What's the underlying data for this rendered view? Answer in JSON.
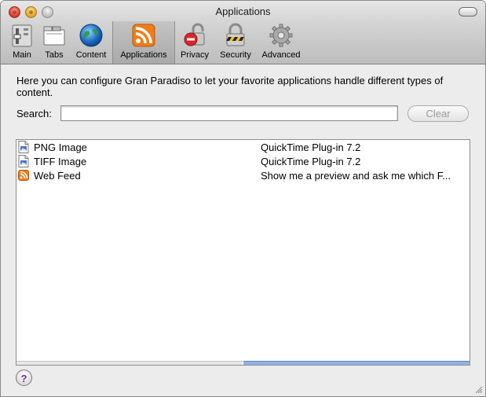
{
  "window": {
    "title": "Applications"
  },
  "toolbar": {
    "items": [
      {
        "label": "Main",
        "icon": "main-switch-icon"
      },
      {
        "label": "Tabs",
        "icon": "tabs-icon"
      },
      {
        "label": "Content",
        "icon": "globe-icon"
      },
      {
        "label": "Applications",
        "icon": "rss-feed-icon",
        "selected": true
      },
      {
        "label": "Privacy",
        "icon": "privacy-icon"
      },
      {
        "label": "Security",
        "icon": "padlock-icon"
      },
      {
        "label": "Advanced",
        "icon": "gear-icon"
      }
    ]
  },
  "description": "Here you can configure Gran Paradiso to let your favorite applications handle different types of content.",
  "search": {
    "label": "Search:",
    "value": "",
    "clear_label": "Clear"
  },
  "list": {
    "rows": [
      {
        "type": "PNG Image",
        "action": "QuickTime Plug-in 7.2",
        "icon": "image-file-icon"
      },
      {
        "type": "TIFF Image",
        "action": "QuickTime Plug-in 7.2",
        "icon": "image-file-icon"
      },
      {
        "type": "Web Feed",
        "action": "Show me a preview and ask me which F...",
        "icon": "rss-feed-icon"
      }
    ]
  },
  "help": {
    "label": "?"
  },
  "colors": {
    "selected_tab": "#b3b3b3",
    "rss_orange": "#f07d18",
    "help_purple": "#6a2ca8"
  }
}
